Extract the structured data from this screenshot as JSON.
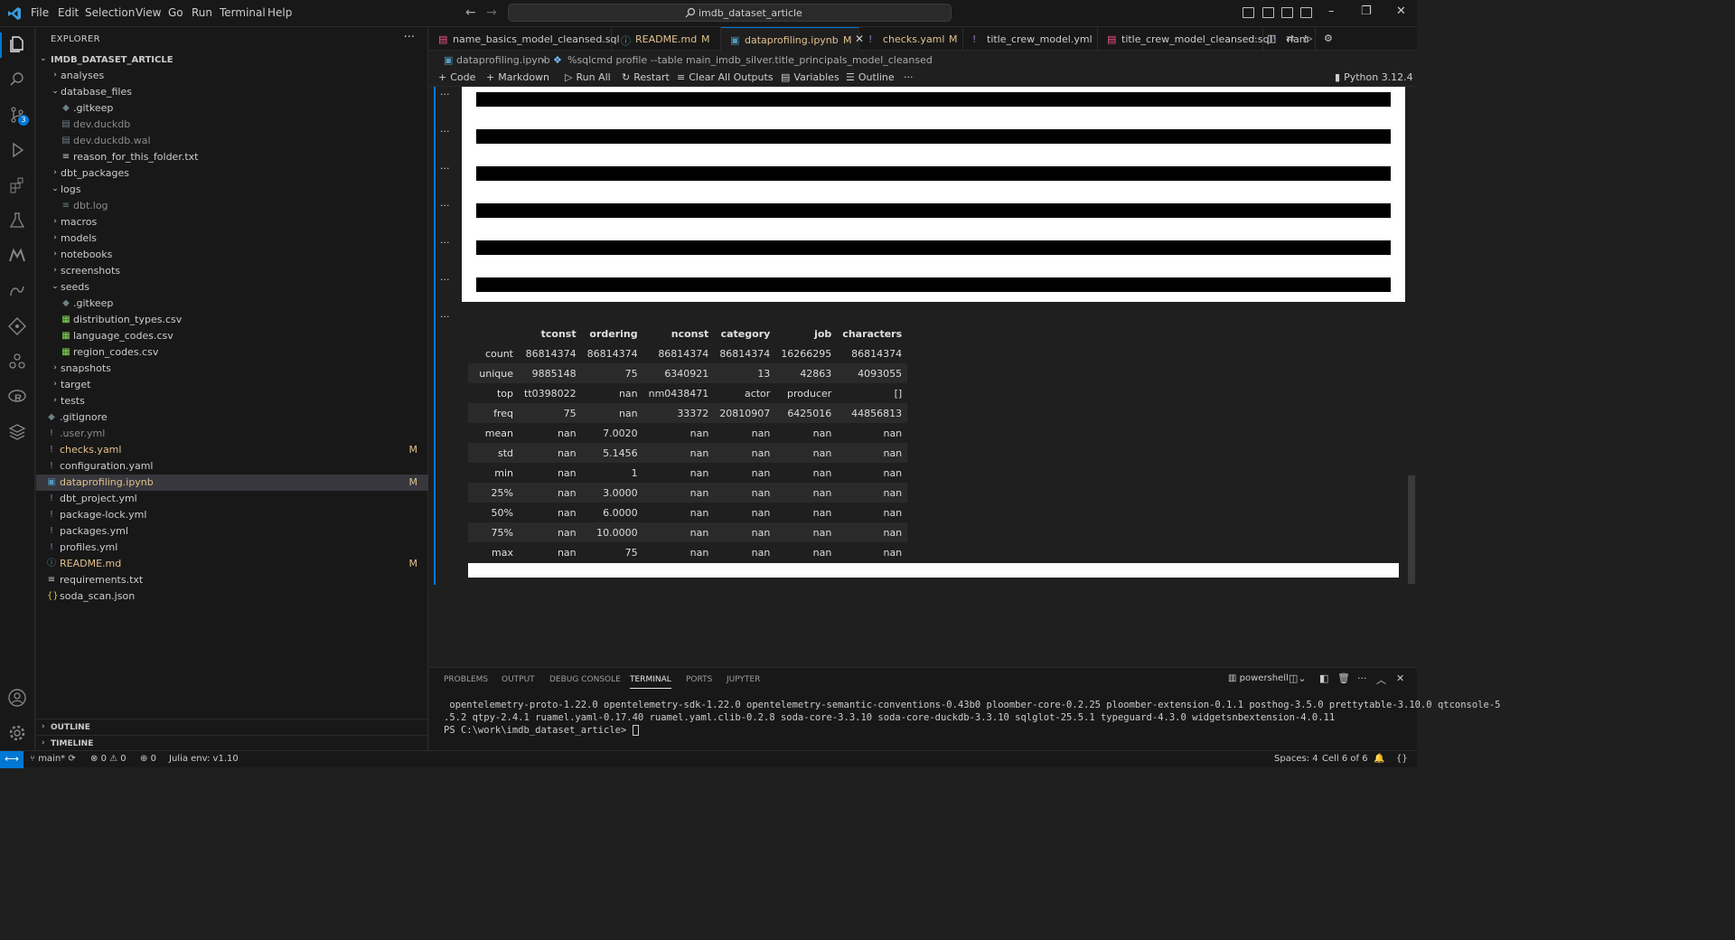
{
  "menubar": {
    "items": [
      "File",
      "Edit",
      "Selection",
      "View",
      "Go",
      "Run",
      "Terminal",
      "Help"
    ],
    "search_text": "imdb_dataset_article"
  },
  "colors": {
    "accent": "#0078d4",
    "modified": "#e2c08d",
    "background": "#1f1f1f",
    "sidebar": "#181818"
  },
  "sidebar": {
    "title": "EXPLORER",
    "root": "IMDB_DATASET_ARTICLE",
    "items": [
      {
        "label": "analyses",
        "type": "folder",
        "open": false,
        "depth": 0
      },
      {
        "label": "database_files",
        "type": "folder",
        "open": true,
        "depth": 0
      },
      {
        "label": ".gitkeep",
        "type": "file",
        "icon": "gitkeep",
        "depth": 1
      },
      {
        "label": "dev.duckdb",
        "type": "file",
        "icon": "db",
        "depth": 1,
        "dim": true
      },
      {
        "label": "dev.duckdb.wal",
        "type": "file",
        "icon": "db",
        "depth": 1,
        "dim": true
      },
      {
        "label": "reason_for_this_folder.txt",
        "type": "file",
        "icon": "txt",
        "depth": 1
      },
      {
        "label": "dbt_packages",
        "type": "folder",
        "open": false,
        "depth": 0
      },
      {
        "label": "logs",
        "type": "folder",
        "open": true,
        "depth": 0
      },
      {
        "label": "dbt.log",
        "type": "file",
        "icon": "log",
        "depth": 1,
        "dim": true
      },
      {
        "label": "macros",
        "type": "folder",
        "open": false,
        "depth": 0
      },
      {
        "label": "models",
        "type": "folder",
        "open": false,
        "depth": 0
      },
      {
        "label": "notebooks",
        "type": "folder",
        "open": false,
        "depth": 0
      },
      {
        "label": "screenshots",
        "type": "folder",
        "open": false,
        "depth": 0
      },
      {
        "label": "seeds",
        "type": "folder",
        "open": true,
        "depth": 0
      },
      {
        "label": ".gitkeep",
        "type": "file",
        "icon": "gitkeep",
        "depth": 1
      },
      {
        "label": "distribution_types.csv",
        "type": "file",
        "icon": "csv",
        "depth": 1
      },
      {
        "label": "language_codes.csv",
        "type": "file",
        "icon": "csv",
        "depth": 1
      },
      {
        "label": "region_codes.csv",
        "type": "file",
        "icon": "csv",
        "depth": 1
      },
      {
        "label": "snapshots",
        "type": "folder",
        "open": false,
        "depth": 0
      },
      {
        "label": "target",
        "type": "folder",
        "open": false,
        "depth": 0
      },
      {
        "label": "tests",
        "type": "folder",
        "open": false,
        "depth": 0
      },
      {
        "label": ".gitignore",
        "type": "file",
        "icon": "gitkeep",
        "depth": 0
      },
      {
        "label": ".user.yml",
        "type": "file",
        "icon": "yml",
        "depth": 0,
        "dim": true
      },
      {
        "label": "checks.yaml",
        "type": "file",
        "icon": "yml",
        "depth": 0,
        "modified": true,
        "badge": "M"
      },
      {
        "label": "configuration.yaml",
        "type": "file",
        "icon": "yml",
        "depth": 0
      },
      {
        "label": "dataprofiling.ipynb",
        "type": "file",
        "icon": "ipynb",
        "depth": 0,
        "modified": true,
        "badge": "M",
        "selected": true
      },
      {
        "label": "dbt_project.yml",
        "type": "file",
        "icon": "yml",
        "depth": 0
      },
      {
        "label": "package-lock.yml",
        "type": "file",
        "icon": "yml",
        "depth": 0
      },
      {
        "label": "packages.yml",
        "type": "file",
        "icon": "yml",
        "depth": 0
      },
      {
        "label": "profiles.yml",
        "type": "file",
        "icon": "yml",
        "depth": 0
      },
      {
        "label": "README.md",
        "type": "file",
        "icon": "md",
        "depth": 0,
        "modified": true,
        "badge": "M"
      },
      {
        "label": "requirements.txt",
        "type": "file",
        "icon": "txt",
        "depth": 0
      },
      {
        "label": "soda_scan.json",
        "type": "file",
        "icon": "json",
        "depth": 0
      }
    ],
    "outline": "OUTLINE",
    "timeline": "TIMELINE"
  },
  "tabs": [
    {
      "label": "name_basics_model_cleansed.sql",
      "icon": "sql"
    },
    {
      "label": "README.md",
      "icon": "md",
      "status": "M"
    },
    {
      "label": "dataprofiling.ipynb",
      "icon": "ipynb",
      "status": "M",
      "active": true
    },
    {
      "label": "checks.yaml",
      "icon": "yml",
      "status": "M"
    },
    {
      "label": "title_crew_model.yml",
      "icon": "yml"
    },
    {
      "label": "title_crew_model_cleansed.sql",
      "icon": "sql"
    },
    {
      "label": "nam",
      "icon": "yml"
    }
  ],
  "breadcrumb": {
    "file": "dataprofiling.ipynb",
    "cell": "%sqlcmd profile --table main_imdb_silver.title_principals_model_cleansed"
  },
  "nb_toolbar": {
    "code": "Code",
    "markdown": "Markdown",
    "run_all": "Run All",
    "restart": "Restart",
    "clear_outputs": "Clear All Outputs",
    "variables": "Variables",
    "outline": "Outline",
    "kernel": "Python 3.12.4"
  },
  "profile_table": {
    "columns": [
      "",
      "tconst",
      "ordering",
      "nconst",
      "category",
      "job",
      "characters"
    ],
    "rows": [
      [
        "count",
        "86814374",
        "86814374",
        "86814374",
        "86814374",
        "16266295",
        "86814374"
      ],
      [
        "unique",
        "9885148",
        "75",
        "6340921",
        "13",
        "42863",
        "4093055"
      ],
      [
        "top",
        "tt0398022",
        "nan",
        "nm0438471",
        "actor",
        "producer",
        "[]"
      ],
      [
        "freq",
        "75",
        "nan",
        "33372",
        "20810907",
        "6425016",
        "44856813"
      ],
      [
        "mean",
        "nan",
        "7.0020",
        "nan",
        "nan",
        "nan",
        "nan"
      ],
      [
        "std",
        "nan",
        "5.1456",
        "nan",
        "nan",
        "nan",
        "nan"
      ],
      [
        "min",
        "nan",
        "1",
        "nan",
        "nan",
        "nan",
        "nan"
      ],
      [
        "25%",
        "nan",
        "3.0000",
        "nan",
        "nan",
        "nan",
        "nan"
      ],
      [
        "50%",
        "nan",
        "6.0000",
        "nan",
        "nan",
        "nan",
        "nan"
      ],
      [
        "75%",
        "nan",
        "10.0000",
        "nan",
        "nan",
        "nan",
        "nan"
      ],
      [
        "max",
        "nan",
        "75",
        "nan",
        "nan",
        "nan",
        "nan"
      ]
    ]
  },
  "panel": {
    "tabs": [
      "PROBLEMS",
      "OUTPUT",
      "DEBUG CONSOLE",
      "TERMINAL",
      "PORTS",
      "JUPYTER"
    ],
    "active_tab": "TERMINAL",
    "shell": "powershell",
    "lines": [
      " opentelemetry-proto-1.22.0 opentelemetry-sdk-1.22.0 opentelemetry-semantic-conventions-0.43b0 ploomber-core-0.2.25 ploomber-extension-0.1.1 posthog-3.5.0 prettytable-3.10.0 qtconsole-5",
      ".5.2 qtpy-2.4.1 ruamel.yaml-0.17.40 ruamel.yaml.clib-0.2.8 soda-core-3.3.10 soda-core-duckdb-3.3.10 sqlglot-25.5.1 typeguard-4.3.0 widgetsnbextension-4.0.11",
      "PS C:\\work\\imdb_dataset_article> "
    ]
  },
  "statusbar": {
    "branch": "main*",
    "errors": "0",
    "warnings": "0",
    "ports": "0",
    "julia": "Julia env: v1.10",
    "spaces": "Spaces: 4",
    "cell": "Cell 6 of 6"
  }
}
